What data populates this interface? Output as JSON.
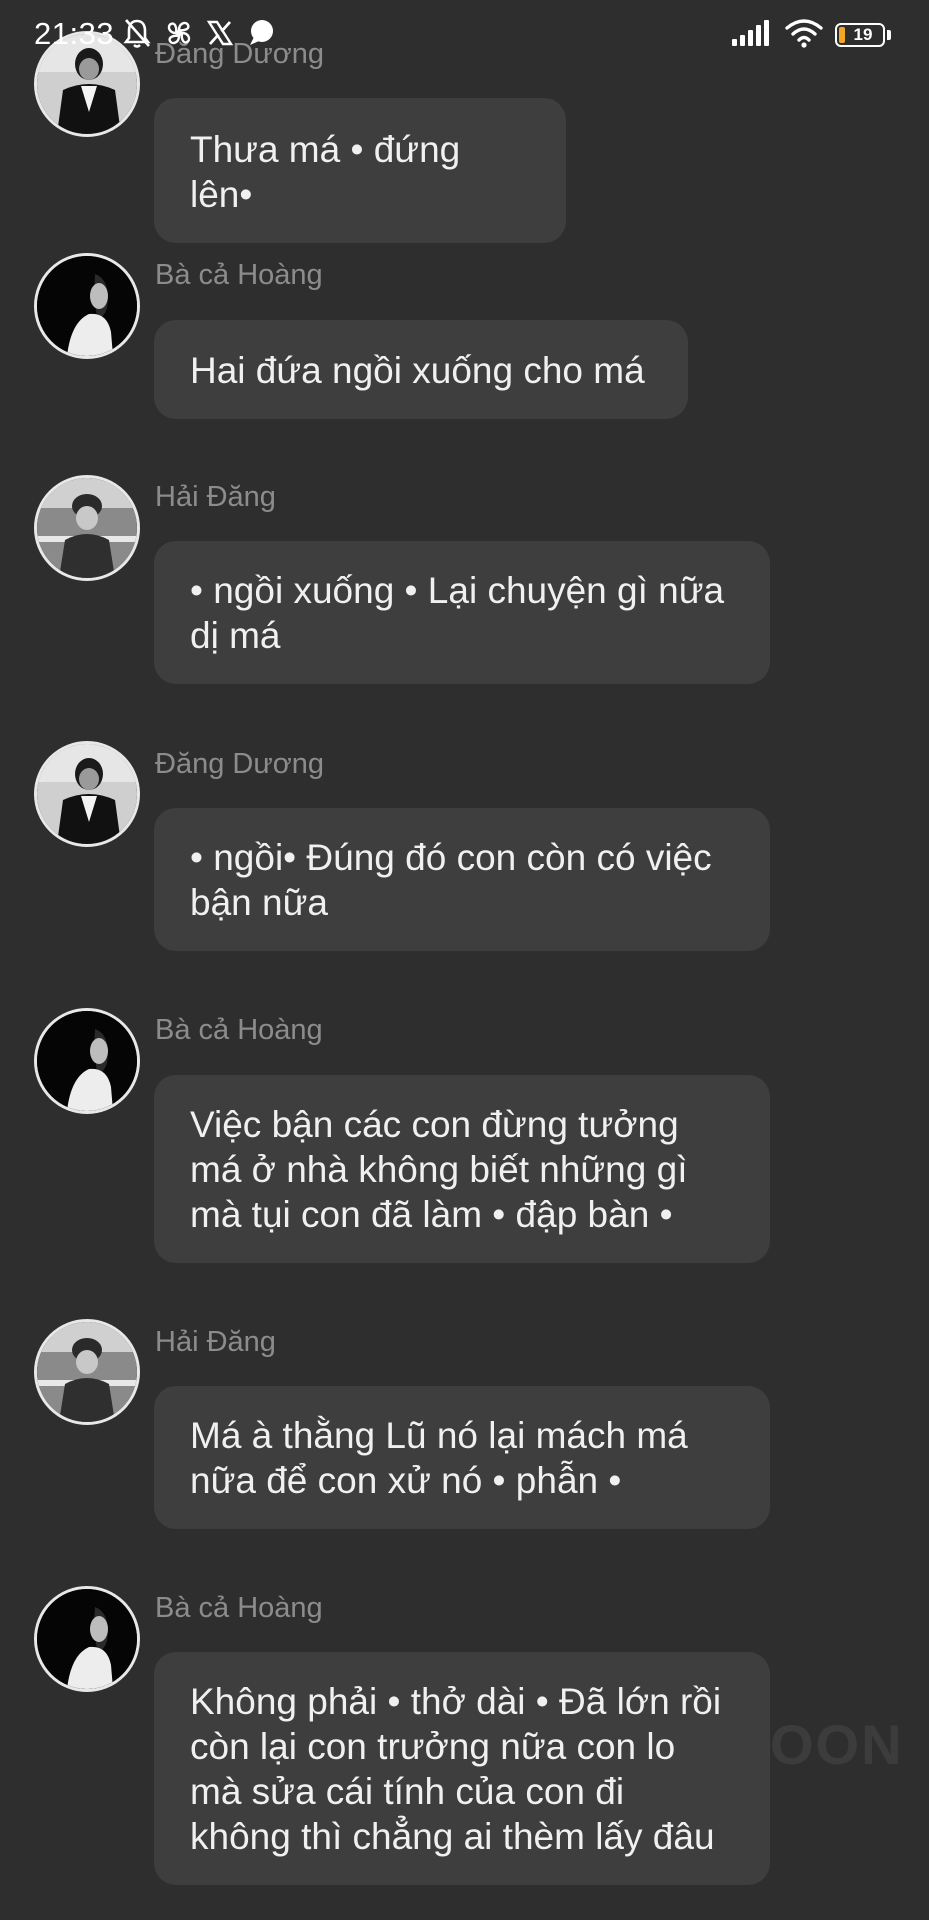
{
  "status_bar": {
    "time": "21:33",
    "battery_level": "19",
    "battery_percent": 19,
    "icons": [
      "notifications-off-icon",
      "pinwheel-icon",
      "x-logo-icon",
      "chat-bubble-icon",
      "signal-icon",
      "wifi-icon",
      "battery-icon"
    ]
  },
  "messages": [
    {
      "sender": "Đăng Dương",
      "text": "Thưa má • đứng lên•",
      "avatar": "avatar-dang-duong"
    },
    {
      "sender": "Bà cả Hoàng",
      "text": "Hai đứa ngồi xuống cho má",
      "avatar": "avatar-ba-ca-hoang"
    },
    {
      "sender": "Hải Đăng",
      "text": "• ngồi xuống • Lại chuyện gì nữa dị má",
      "avatar": "avatar-hai-dang"
    },
    {
      "sender": "Đăng Dương",
      "text": "• ngồi• Đúng đó con còn có việc bận nữa",
      "avatar": "avatar-dang-duong"
    },
    {
      "sender": "Bà cả Hoàng",
      "text": "Việc bận các con đừng tưởng má ở nhà không biết những gì mà tụi con đã làm • đập bàn •",
      "avatar": "avatar-ba-ca-hoang"
    },
    {
      "sender": "Hải Đăng",
      "text": "Má à thằng Lũ nó lại mách má nữa để con xử nó • phẫn •",
      "avatar": "avatar-hai-dang"
    },
    {
      "sender": "Bà cả Hoàng",
      "text": "Không phải • thở dài • Đã lớn rồi còn lại con trưởng nữa con lo mà sửa cái tính của con đi không thì chẳng ai thèm lấy đâu",
      "avatar": "avatar-ba-ca-hoang"
    }
  ],
  "watermark": "OON",
  "colors": {
    "background": "#2e2e2e",
    "bubble": "#3e3e3e",
    "sender_name": "#8c8c8c",
    "message_text": "#f0f0f0",
    "battery_fill": "#f5a623"
  }
}
